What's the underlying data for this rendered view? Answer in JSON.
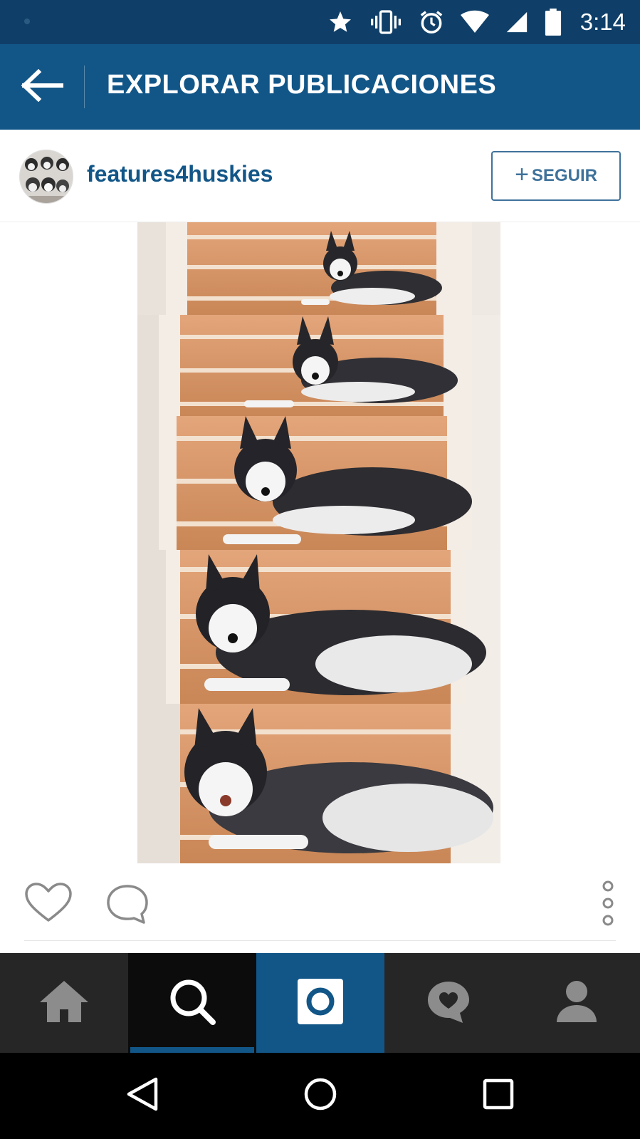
{
  "status_bar": {
    "time": "3:14",
    "icons": [
      "star-icon",
      "vibrate-icon",
      "alarm-icon",
      "wifi-icon",
      "signal-icon",
      "battery-icon"
    ]
  },
  "app_bar": {
    "title": "EXPLORAR PUBLICACIONES",
    "back_icon": "arrow-left-icon",
    "color": "#125688"
  },
  "post": {
    "username": "features4huskies",
    "follow_label": "SEGUIR",
    "follow_icon": "plus-icon",
    "photo_subject": "husky-puppy-growth-on-stairs",
    "actions": [
      "heart-icon",
      "comment-icon",
      "more-vertical-icon"
    ]
  },
  "tab_bar": {
    "tabs": [
      {
        "name": "home",
        "icon": "home-icon",
        "selected": false
      },
      {
        "name": "search",
        "icon": "search-icon",
        "selected": true
      },
      {
        "name": "camera",
        "icon": "camera-icon",
        "selected": false
      },
      {
        "name": "activity",
        "icon": "heart-bubble-icon",
        "selected": false
      },
      {
        "name": "profile",
        "icon": "person-icon",
        "selected": false
      }
    ]
  },
  "nav_bar": {
    "buttons": [
      "back-triangle-icon",
      "home-circle-icon",
      "recents-square-icon"
    ]
  }
}
